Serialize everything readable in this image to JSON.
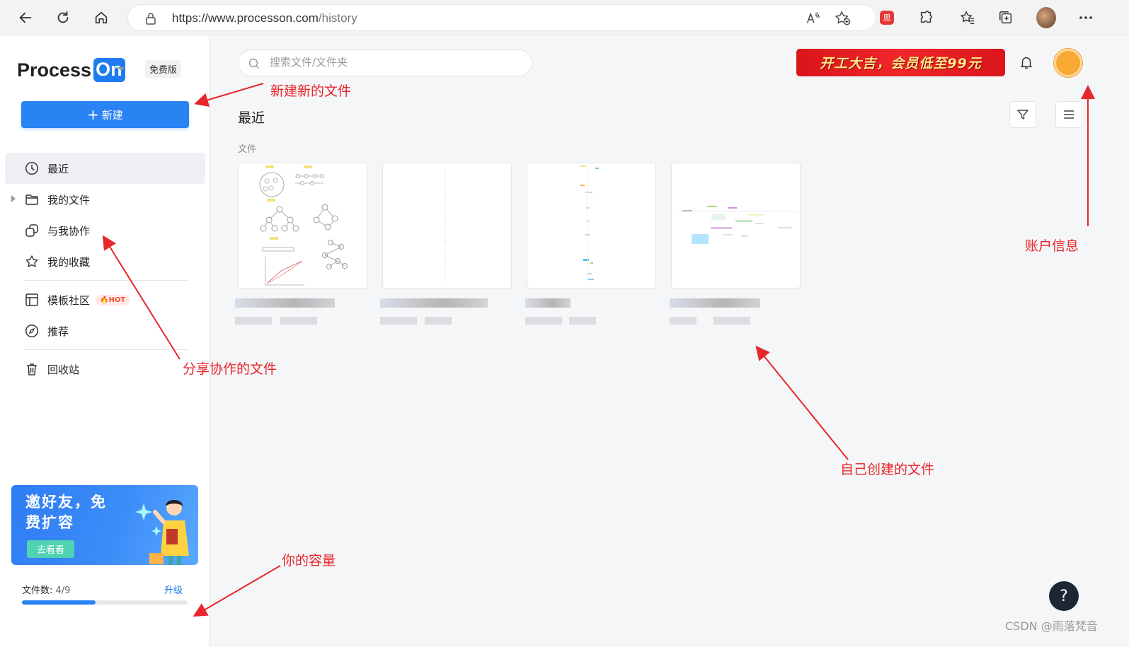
{
  "browser": {
    "url_host": "https://www.processon.com",
    "url_path": "/history",
    "ext_label": "思"
  },
  "sidebar": {
    "logo_text": "Process",
    "logo_on": "On",
    "plan": "免费版",
    "new_button": "新建",
    "menu": [
      {
        "label": "最近"
      },
      {
        "label": "我的文件"
      },
      {
        "label": "与我协作"
      },
      {
        "label": "我的收藏"
      },
      {
        "label": "模板社区",
        "badge": "HOT"
      },
      {
        "label": "推荐"
      },
      {
        "label": "回收站"
      }
    ],
    "promo": {
      "title": "邀好友，免费扩容",
      "button": "去看看"
    },
    "quota": {
      "label": "文件数:",
      "value": "4/9",
      "fraction": 0.444,
      "upgrade": "升级"
    }
  },
  "main": {
    "search_placeholder": "搜索文件/文件夹",
    "banner": "开工大吉，会员低至99元",
    "page_title": "最近",
    "section_label": "文件",
    "help": "?",
    "watermark": "CSDN @雨落梵音"
  },
  "annotations": {
    "new_file": "新建新的文件",
    "account": "账户信息",
    "shared": "分享协作的文件",
    "own_files": "自己创建的文件",
    "capacity": "你的容量"
  },
  "colors": {
    "accent": "#2a83f2",
    "annotation": "#e8262b",
    "banner": "#e51d22"
  }
}
